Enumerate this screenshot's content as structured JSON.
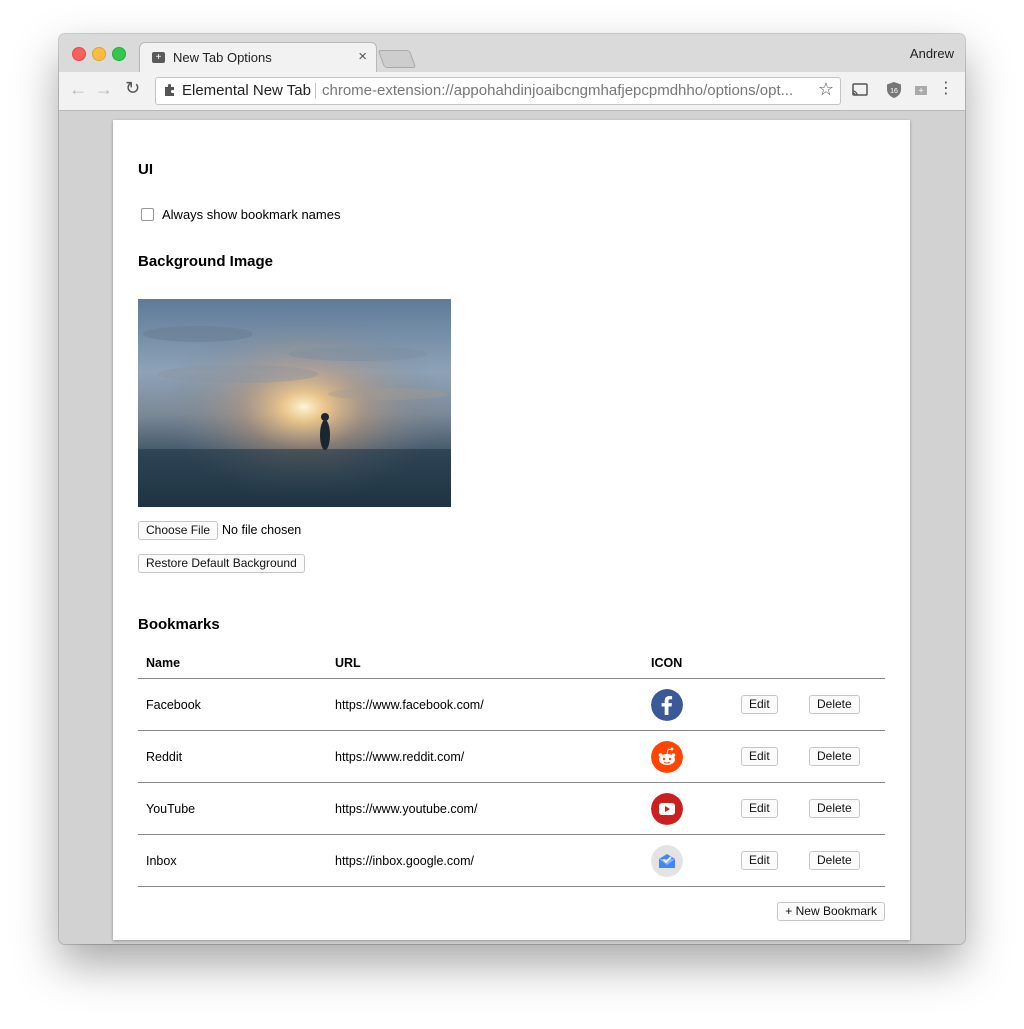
{
  "window": {
    "tab_title": "New Tab Options",
    "tab_close": "×",
    "profile_name": "Andrew"
  },
  "toolbar": {
    "back_icon": "←",
    "forward_icon": "→",
    "reload_icon": "↻",
    "extension_name": "Elemental New Tab",
    "url": "chrome-extension://appohahdinjoaibcngmhafjepcpmdhho/options/opt...",
    "star_icon": "☆",
    "menu_icon": "⋮"
  },
  "ui_section": {
    "heading": "UI",
    "always_show_names_label": "Always show bookmark names",
    "always_show_names_checked": false
  },
  "background_section": {
    "heading": "Background Image",
    "choose_file_label": "Choose File",
    "file_status": "No file chosen",
    "restore_label": "Restore Default Background"
  },
  "bookmarks_section": {
    "heading": "Bookmarks",
    "columns": [
      "Name",
      "URL",
      "ICON"
    ],
    "rows": [
      {
        "name": "Facebook",
        "url": "https://www.facebook.com/",
        "icon": "facebook-icon",
        "color": "#3b5998"
      },
      {
        "name": "Reddit",
        "url": "https://www.reddit.com/",
        "icon": "reddit-icon",
        "color": "#ff4500"
      },
      {
        "name": "YouTube",
        "url": "https://www.youtube.com/",
        "icon": "youtube-icon",
        "color": "#cc1f1f"
      },
      {
        "name": "Inbox",
        "url": "https://inbox.google.com/",
        "icon": "inbox-icon",
        "color": "#e3e3e3"
      }
    ],
    "edit_label": "Edit",
    "delete_label": "Delete",
    "new_bookmark_label": "+ New Bookmark"
  }
}
